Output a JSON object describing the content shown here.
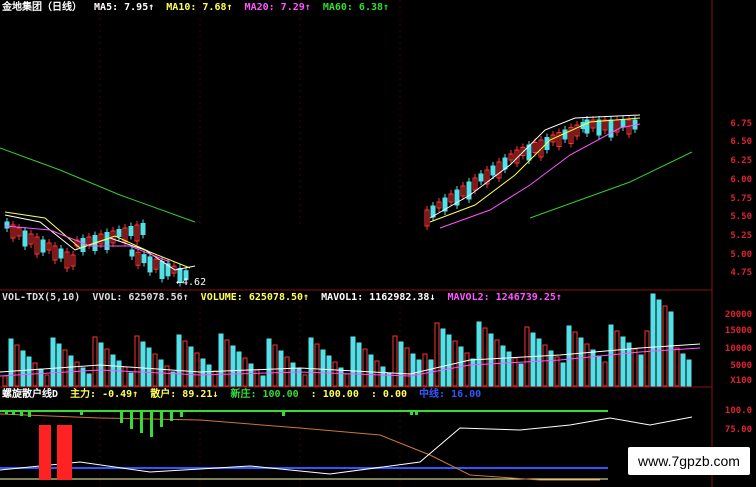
{
  "price_header": {
    "title": "金地集团（日线）",
    "ma5": "MA5: 7.95↑",
    "ma10": "MA10: 7.68↑",
    "ma20": "MA20: 7.29↑",
    "ma60": "MA60: 6.38↑"
  },
  "price_axis": [
    "6.75",
    "6.50",
    "6.25",
    "6.00",
    "5.75",
    "5.50",
    "5.25",
    "5.00",
    "4.75"
  ],
  "low_label": "←4.62",
  "volume_header": {
    "name": "VOL-TDX(5,10)",
    "vvol": "VVOL: 625078.56↑",
    "volume": "VOLUME: 625078.50↑",
    "mavol1": "MAVOL1: 1162982.38↓",
    "mavol2": "MAVOL2: 1246739.25↑"
  },
  "volume_axis": [
    "20000",
    "15000",
    "10000",
    "5000",
    "X100"
  ],
  "indicator_header": {
    "name": "螺旋散户线D",
    "main": "主力: -0.49↑",
    "retail": "散户: 89.21↓",
    "new_dealer": "新庄: 100.00",
    "blank": ": 100.00",
    "zero": ": 0.00",
    "mid": "中线: 16.00"
  },
  "indicator_axis": [
    "100.0",
    "75.00"
  ],
  "watermark": "www.7gpzb.com",
  "colors": {
    "up": "#ff3333",
    "down": "#55e0e8",
    "ma5": "#ffffff",
    "ma10": "#ffff55",
    "ma20": "#ff55ff",
    "ma60": "#33cc33",
    "grid": "#8a1010"
  }
}
